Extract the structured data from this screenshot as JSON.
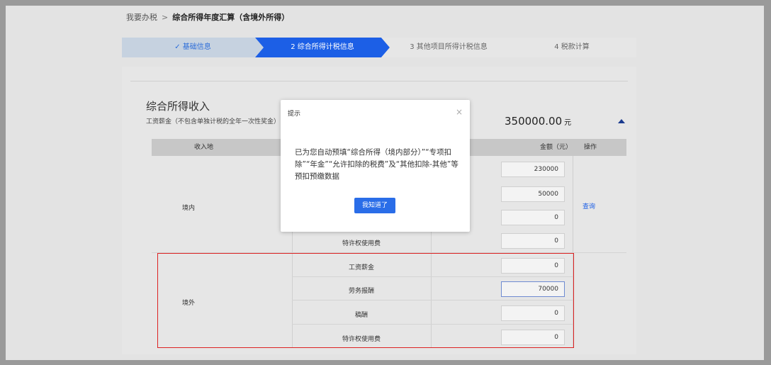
{
  "breadcrumb": {
    "home": "我要办税",
    "separator": ">",
    "current": "综合所得年度汇算（含境外所得）"
  },
  "steps": [
    {
      "label": "✓ 基础信息"
    },
    {
      "label": "2 综合所得计税信息"
    },
    {
      "label": "3 其他项目所得计税信息"
    },
    {
      "label": "4 税款计算"
    }
  ],
  "section": {
    "title": "综合所得收入",
    "subtitle": "工资薪金（不包含单独计税的全年一次性奖金）",
    "total": "350000.00",
    "total_unit": "元"
  },
  "table": {
    "headers": [
      "收入地",
      "金额（元）",
      "操作"
    ],
    "domestic": {
      "region": "境内",
      "action": "查询",
      "rows": [
        {
          "type": "",
          "amount": "230000"
        },
        {
          "type": "",
          "amount": "50000"
        },
        {
          "type": "",
          "amount": "0"
        },
        {
          "type": "特许权使用费",
          "amount": "0"
        }
      ]
    },
    "foreign": {
      "region": "境外",
      "rows": [
        {
          "type": "工资薪金",
          "amount": "0"
        },
        {
          "type": "劳务报酬",
          "amount": "70000"
        },
        {
          "type": "稿酬",
          "amount": "0"
        },
        {
          "type": "特许权使用费",
          "amount": "0"
        }
      ]
    }
  },
  "modal": {
    "title": "提示",
    "close": "×",
    "body": "已为您自动预填“综合所得（境内部分）”“专项扣除”“年金”“允许扣除的税费”及“其他扣除-其他”等预扣预缴数据",
    "button": "我知道了"
  },
  "colors": {
    "accent": "#1c5fe6",
    "highlight_border": "#dd2222"
  }
}
